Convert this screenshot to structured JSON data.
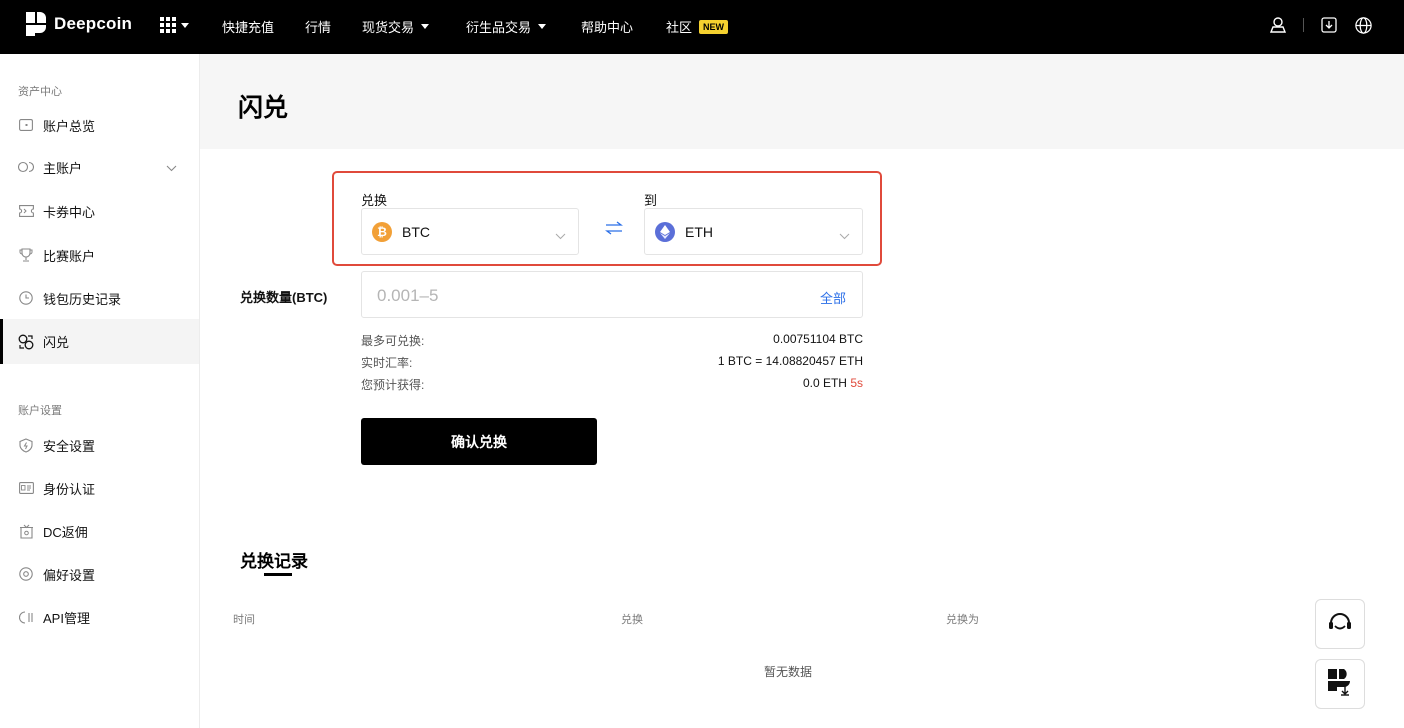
{
  "topbar": {
    "brand": "Deepcoin",
    "nav": [
      {
        "label": "快捷充值",
        "dropdown": false
      },
      {
        "label": "行情",
        "dropdown": false
      },
      {
        "label": "现货交易",
        "dropdown": true
      },
      {
        "label": "衍生品交易",
        "dropdown": true
      },
      {
        "label": "帮助中心",
        "dropdown": false
      },
      {
        "label": "社区",
        "dropdown": false,
        "badge": "NEW"
      }
    ],
    "icons": [
      "grid-menu-icon",
      "user-icon",
      "download-icon",
      "globe-icon"
    ]
  },
  "sidebar": {
    "section1": "资产中心",
    "section2": "账户设置",
    "items": [
      {
        "label": "账户总览",
        "icon": "wallet-icon"
      },
      {
        "label": "主账户",
        "icon": "account-icon",
        "expandable": true
      },
      {
        "label": "卡券中心",
        "icon": "ticket-icon"
      },
      {
        "label": "比赛账户",
        "icon": "trophy-icon"
      },
      {
        "label": "钱包历史记录",
        "icon": "clock-icon"
      },
      {
        "label": "闪兑",
        "icon": "swap-icon",
        "active": true
      },
      {
        "label": "安全设置",
        "icon": "shield-icon"
      },
      {
        "label": "身份认证",
        "icon": "id-card-icon"
      },
      {
        "label": "DC返佣",
        "icon": "gift-icon"
      },
      {
        "label": "偏好设置",
        "icon": "settings-icon"
      },
      {
        "label": "API管理",
        "icon": "api-icon"
      }
    ]
  },
  "page": {
    "title": "闪兑"
  },
  "swap": {
    "from_label": "兑换",
    "to_label": "到",
    "from_coin": "BTC",
    "to_coin": "ETH",
    "from_coin_symbol": "₿",
    "amount_label": "兑换数量(BTC)",
    "amount_placeholder": "0.001–5",
    "all_label": "全部",
    "max_label": "最多可兑换:",
    "max_value": "0.00751104 BTC",
    "rate_label": "实时汇率:",
    "rate_value": "1 BTC = 14.08820457 ETH",
    "estimate_label": "您预计获得:",
    "estimate_value": "0.0 ETH",
    "countdown": "5s",
    "confirm_label": "确认兑换",
    "colors": {
      "btc": "#f2a037",
      "eth": "#5b6fd8",
      "highlight": "#e04a3b",
      "link": "#2b6fe8"
    }
  },
  "records": {
    "title": "兑换记录",
    "columns": [
      "时间",
      "兑换",
      "兑换为"
    ],
    "empty": "暂无数据"
  },
  "floating": [
    "support-headset-icon",
    "app-download-icon"
  ]
}
